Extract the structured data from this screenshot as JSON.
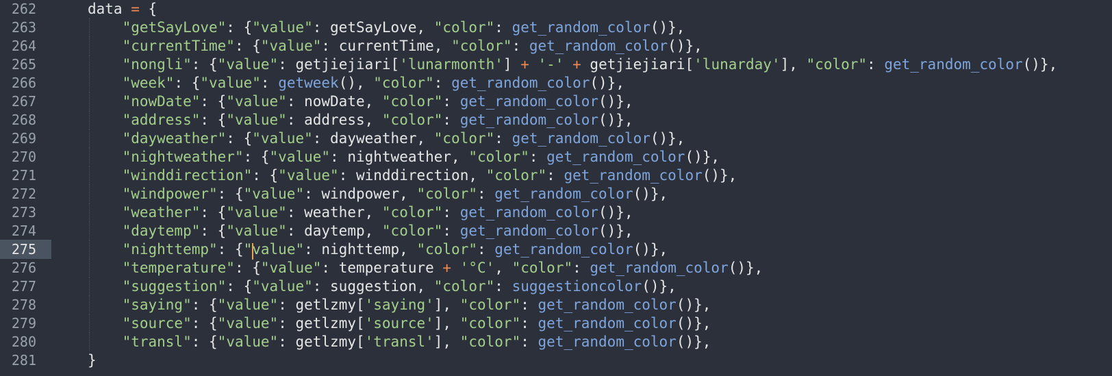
{
  "editor": {
    "active_line": "275",
    "lines": [
      {
        "num": "262",
        "t": [
          {
            "k": "p",
            "v": "data "
          },
          {
            "k": "o",
            "v": "="
          },
          {
            "k": "p",
            "v": " {"
          }
        ]
      },
      {
        "num": "263",
        "t": [
          {
            "k": "s",
            "v": "\"getSayLove\""
          },
          {
            "k": "p",
            "v": ": {"
          },
          {
            "k": "s",
            "v": "\"value\""
          },
          {
            "k": "p",
            "v": ": getSayLove, "
          },
          {
            "k": "s",
            "v": "\"color\""
          },
          {
            "k": "p",
            "v": ": "
          },
          {
            "k": "f",
            "v": "get_random_color"
          },
          {
            "k": "p",
            "v": "()},"
          }
        ]
      },
      {
        "num": "264",
        "t": [
          {
            "k": "s",
            "v": "\"currentTime\""
          },
          {
            "k": "p",
            "v": ": {"
          },
          {
            "k": "s",
            "v": "\"value\""
          },
          {
            "k": "p",
            "v": ": currentTime, "
          },
          {
            "k": "s",
            "v": "\"color\""
          },
          {
            "k": "p",
            "v": ": "
          },
          {
            "k": "f",
            "v": "get_random_color"
          },
          {
            "k": "p",
            "v": "()},"
          }
        ]
      },
      {
        "num": "265",
        "t": [
          {
            "k": "s",
            "v": "\"nongli\""
          },
          {
            "k": "p",
            "v": ": {"
          },
          {
            "k": "s",
            "v": "\"value\""
          },
          {
            "k": "p",
            "v": ": getjiejiari["
          },
          {
            "k": "s",
            "v": "'lunarmonth'"
          },
          {
            "k": "p",
            "v": "] "
          },
          {
            "k": "o",
            "v": "+"
          },
          {
            "k": "p",
            "v": " "
          },
          {
            "k": "s",
            "v": "'-'"
          },
          {
            "k": "p",
            "v": " "
          },
          {
            "k": "o",
            "v": "+"
          },
          {
            "k": "p",
            "v": " getjiejiari["
          },
          {
            "k": "s",
            "v": "'lunarday'"
          },
          {
            "k": "p",
            "v": "], "
          },
          {
            "k": "s",
            "v": "\"color\""
          },
          {
            "k": "p",
            "v": ": "
          },
          {
            "k": "f",
            "v": "get_random_color"
          },
          {
            "k": "p",
            "v": "()},"
          }
        ]
      },
      {
        "num": "266",
        "t": [
          {
            "k": "s",
            "v": "\"week\""
          },
          {
            "k": "p",
            "v": ": {"
          },
          {
            "k": "s",
            "v": "\"value\""
          },
          {
            "k": "p",
            "v": ": "
          },
          {
            "k": "f",
            "v": "getweek"
          },
          {
            "k": "p",
            "v": "(), "
          },
          {
            "k": "s",
            "v": "\"color\""
          },
          {
            "k": "p",
            "v": ": "
          },
          {
            "k": "f",
            "v": "get_random_color"
          },
          {
            "k": "p",
            "v": "()},"
          }
        ]
      },
      {
        "num": "267",
        "t": [
          {
            "k": "s",
            "v": "\"nowDate\""
          },
          {
            "k": "p",
            "v": ": {"
          },
          {
            "k": "s",
            "v": "\"value\""
          },
          {
            "k": "p",
            "v": ": nowDate, "
          },
          {
            "k": "s",
            "v": "\"color\""
          },
          {
            "k": "p",
            "v": ": "
          },
          {
            "k": "f",
            "v": "get_random_color"
          },
          {
            "k": "p",
            "v": "()},"
          }
        ]
      },
      {
        "num": "268",
        "t": [
          {
            "k": "s",
            "v": "\"address\""
          },
          {
            "k": "p",
            "v": ": {"
          },
          {
            "k": "s",
            "v": "\"value\""
          },
          {
            "k": "p",
            "v": ": address, "
          },
          {
            "k": "s",
            "v": "\"color\""
          },
          {
            "k": "p",
            "v": ": "
          },
          {
            "k": "f",
            "v": "get_random_color"
          },
          {
            "k": "p",
            "v": "()},"
          }
        ]
      },
      {
        "num": "269",
        "t": [
          {
            "k": "s",
            "v": "\"dayweather\""
          },
          {
            "k": "p",
            "v": ": {"
          },
          {
            "k": "s",
            "v": "\"value\""
          },
          {
            "k": "p",
            "v": ": dayweather, "
          },
          {
            "k": "s",
            "v": "\"color\""
          },
          {
            "k": "p",
            "v": ": "
          },
          {
            "k": "f",
            "v": "get_random_color"
          },
          {
            "k": "p",
            "v": "()},"
          }
        ]
      },
      {
        "num": "270",
        "t": [
          {
            "k": "s",
            "v": "\"nightweather\""
          },
          {
            "k": "p",
            "v": ": {"
          },
          {
            "k": "s",
            "v": "\"value\""
          },
          {
            "k": "p",
            "v": ": nightweather, "
          },
          {
            "k": "s",
            "v": "\"color\""
          },
          {
            "k": "p",
            "v": ": "
          },
          {
            "k": "f",
            "v": "get_random_color"
          },
          {
            "k": "p",
            "v": "()},"
          }
        ]
      },
      {
        "num": "271",
        "t": [
          {
            "k": "s",
            "v": "\"winddirection\""
          },
          {
            "k": "p",
            "v": ": {"
          },
          {
            "k": "s",
            "v": "\"value\""
          },
          {
            "k": "p",
            "v": ": winddirection, "
          },
          {
            "k": "s",
            "v": "\"color\""
          },
          {
            "k": "p",
            "v": ": "
          },
          {
            "k": "f",
            "v": "get_random_color"
          },
          {
            "k": "p",
            "v": "()},"
          }
        ]
      },
      {
        "num": "272",
        "t": [
          {
            "k": "s",
            "v": "\"windpower\""
          },
          {
            "k": "p",
            "v": ": {"
          },
          {
            "k": "s",
            "v": "\"value\""
          },
          {
            "k": "p",
            "v": ": windpower, "
          },
          {
            "k": "s",
            "v": "\"color\""
          },
          {
            "k": "p",
            "v": ": "
          },
          {
            "k": "f",
            "v": "get_random_color"
          },
          {
            "k": "p",
            "v": "()},"
          }
        ]
      },
      {
        "num": "273",
        "t": [
          {
            "k": "s",
            "v": "\"weather\""
          },
          {
            "k": "p",
            "v": ": {"
          },
          {
            "k": "s",
            "v": "\"value\""
          },
          {
            "k": "p",
            "v": ": weather, "
          },
          {
            "k": "s",
            "v": "\"color\""
          },
          {
            "k": "p",
            "v": ": "
          },
          {
            "k": "f",
            "v": "get_random_color"
          },
          {
            "k": "p",
            "v": "()},"
          }
        ]
      },
      {
        "num": "274",
        "t": [
          {
            "k": "s",
            "v": "\"daytemp\""
          },
          {
            "k": "p",
            "v": ": {"
          },
          {
            "k": "s",
            "v": "\"value\""
          },
          {
            "k": "p",
            "v": ": daytemp, "
          },
          {
            "k": "s",
            "v": "\"color\""
          },
          {
            "k": "p",
            "v": ": "
          },
          {
            "k": "f",
            "v": "get_random_color"
          },
          {
            "k": "p",
            "v": "()},"
          }
        ]
      },
      {
        "num": "275",
        "t": [
          {
            "k": "s",
            "v": "\"nighttemp\""
          },
          {
            "k": "p",
            "v": ": {"
          },
          {
            "k": "s",
            "v": "\""
          },
          {
            "k": "caret",
            "v": ""
          },
          {
            "k": "s",
            "v": "value\""
          },
          {
            "k": "p",
            "v": ": nighttemp, "
          },
          {
            "k": "s",
            "v": "\"color\""
          },
          {
            "k": "p",
            "v": ": "
          },
          {
            "k": "f",
            "v": "get_random_color"
          },
          {
            "k": "p",
            "v": "()},"
          }
        ]
      },
      {
        "num": "276",
        "t": [
          {
            "k": "s",
            "v": "\"temperature\""
          },
          {
            "k": "p",
            "v": ": {"
          },
          {
            "k": "s",
            "v": "\"value\""
          },
          {
            "k": "p",
            "v": ": temperature "
          },
          {
            "k": "o",
            "v": "+"
          },
          {
            "k": "p",
            "v": " "
          },
          {
            "k": "s",
            "v": "'°C'"
          },
          {
            "k": "p",
            "v": ", "
          },
          {
            "k": "s",
            "v": "\"color\""
          },
          {
            "k": "p",
            "v": ": "
          },
          {
            "k": "f",
            "v": "get_random_color"
          },
          {
            "k": "p",
            "v": "()},"
          }
        ]
      },
      {
        "num": "277",
        "t": [
          {
            "k": "s",
            "v": "\"suggestion\""
          },
          {
            "k": "p",
            "v": ": {"
          },
          {
            "k": "s",
            "v": "\"value\""
          },
          {
            "k": "p",
            "v": ": suggestion, "
          },
          {
            "k": "s",
            "v": "\"color\""
          },
          {
            "k": "p",
            "v": ": "
          },
          {
            "k": "f",
            "v": "suggestioncolor"
          },
          {
            "k": "p",
            "v": "()},"
          }
        ]
      },
      {
        "num": "278",
        "t": [
          {
            "k": "s",
            "v": "\"saying\""
          },
          {
            "k": "p",
            "v": ": {"
          },
          {
            "k": "s",
            "v": "\"value\""
          },
          {
            "k": "p",
            "v": ": getlzmy["
          },
          {
            "k": "s",
            "v": "'saying'"
          },
          {
            "k": "p",
            "v": "], "
          },
          {
            "k": "s",
            "v": "\"color\""
          },
          {
            "k": "p",
            "v": ": "
          },
          {
            "k": "f",
            "v": "get_random_color"
          },
          {
            "k": "p",
            "v": "()},"
          }
        ]
      },
      {
        "num": "279",
        "t": [
          {
            "k": "s",
            "v": "\"source\""
          },
          {
            "k": "p",
            "v": ": {"
          },
          {
            "k": "s",
            "v": "\"value\""
          },
          {
            "k": "p",
            "v": ": getlzmy["
          },
          {
            "k": "s",
            "v": "'source'"
          },
          {
            "k": "p",
            "v": "], "
          },
          {
            "k": "s",
            "v": "\"color\""
          },
          {
            "k": "p",
            "v": ": "
          },
          {
            "k": "f",
            "v": "get_random_color"
          },
          {
            "k": "p",
            "v": "()},"
          }
        ]
      },
      {
        "num": "280",
        "t": [
          {
            "k": "s",
            "v": "\"transl\""
          },
          {
            "k": "p",
            "v": ": {"
          },
          {
            "k": "s",
            "v": "\"value\""
          },
          {
            "k": "p",
            "v": ": getlzmy["
          },
          {
            "k": "s",
            "v": "'transl'"
          },
          {
            "k": "p",
            "v": "], "
          },
          {
            "k": "s",
            "v": "\"color\""
          },
          {
            "k": "p",
            "v": ": "
          },
          {
            "k": "f",
            "v": "get_random_color"
          },
          {
            "k": "p",
            "v": "()},"
          }
        ]
      },
      {
        "num": "281",
        "t": [
          {
            "k": "p",
            "v": "}"
          }
        ]
      }
    ]
  },
  "colors": {
    "background": "#2b303b",
    "string": "#a3cf8b",
    "function": "#7fa5dd",
    "operator": "#ef8a55",
    "text": "#e6e6e6",
    "caret": "#f0a34a",
    "active_gutter": "#4a5360"
  }
}
